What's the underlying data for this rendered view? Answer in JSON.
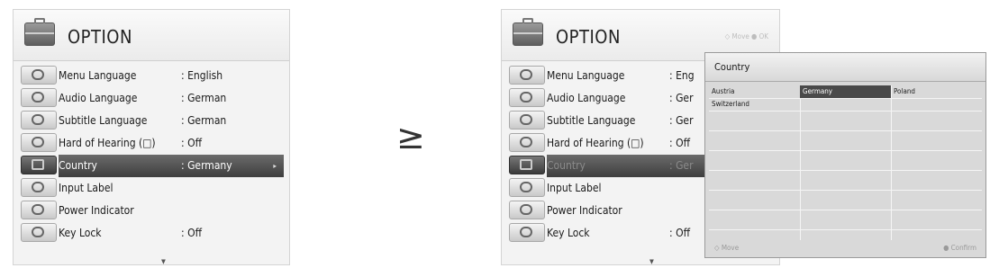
{
  "left_menu": {
    "title": "OPTION",
    "items": [
      {
        "label": "Menu Language",
        "value": ": English"
      },
      {
        "label": "Audio Language",
        "value": ": German"
      },
      {
        "label": "Subtitle Language",
        "value": ": German"
      },
      {
        "label": "Hard of Hearing (□)",
        "value": ": Off"
      },
      {
        "label": "Country",
        "value": ": Germany"
      },
      {
        "label": "Input Label",
        "value": ""
      },
      {
        "label": "Power Indicator",
        "value": ""
      },
      {
        "label": "Key Lock",
        "value": ": Off"
      }
    ],
    "selected_arrow": "▸",
    "scroll_glyph": "▼"
  },
  "arrow_glyph": "≥",
  "right_menu": {
    "title": "OPTION",
    "hints": "◇ Move   ● OK",
    "items": [
      {
        "label": "Menu Language",
        "value": ": Eng"
      },
      {
        "label": "Audio Language",
        "value": ": Ger"
      },
      {
        "label": "Subtitle Language",
        "value": ": Ger"
      },
      {
        "label": "Hard of Hearing (□)",
        "value": ": Off"
      },
      {
        "label": "Country",
        "value": ": Ger"
      },
      {
        "label": "Input Label",
        "value": ""
      },
      {
        "label": "Power Indicator",
        "value": ""
      },
      {
        "label": "Key Lock",
        "value": ": Off"
      }
    ],
    "scroll_glyph": "▼"
  },
  "country_popup": {
    "title": "Country",
    "options": [
      "Austria",
      "Germany",
      "Poland",
      "Switzerland"
    ],
    "selected": "Germany",
    "foot_left": "◇ Move",
    "foot_right": "● Confirm"
  },
  "colors": {
    "highlight": "#4a4a4a",
    "panel": "#f3f3f3",
    "popup": "#d9d9d9"
  }
}
